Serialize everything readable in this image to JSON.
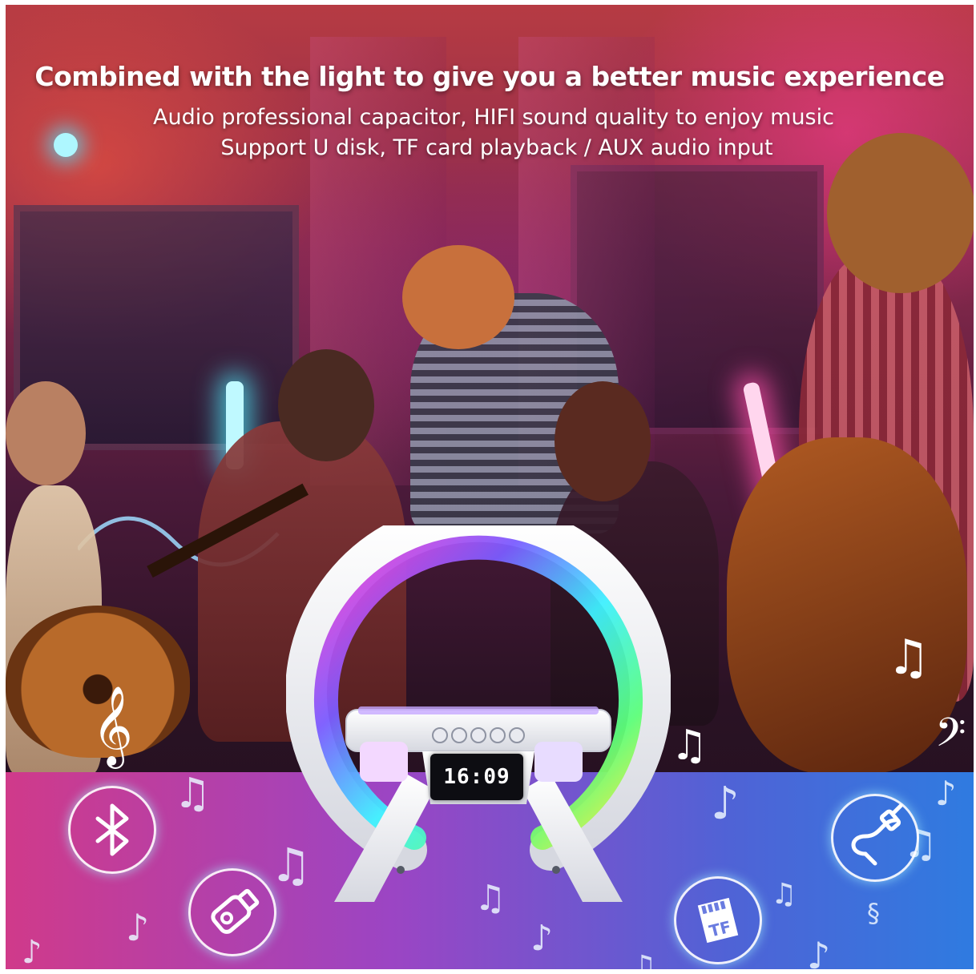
{
  "headline": "Combined with the light to give you a better music experience",
  "subline_1": "Audio professional capacitor, HIFI sound quality to enjoy music",
  "subline_2": "Support U disk, TF card playback / AUX audio input",
  "clock_display": "16:09",
  "feature_icons": {
    "bluetooth": "bluetooth-icon",
    "u_disk": "usb-drive-icon",
    "tf_card": "tf-card-icon",
    "tf_card_label": "TF",
    "aux": "aux-cable-icon"
  },
  "colors": {
    "band_left": "#d03a8a",
    "band_right": "#2f7be0",
    "ring_cyan": "#3ff0ff",
    "ring_magenta": "#ff3fd0",
    "ring_yellow": "#f7ee3a"
  }
}
